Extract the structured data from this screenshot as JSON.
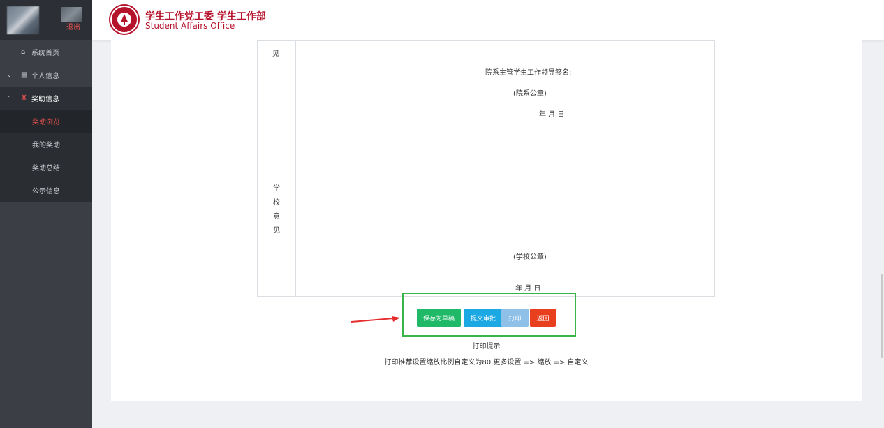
{
  "sidebar": {
    "logout": "退出",
    "menu": [
      {
        "label": "系统首页",
        "icon": "home-icon"
      },
      {
        "label": "个人信息",
        "icon": "id-card-icon"
      },
      {
        "label": "奖助信息",
        "icon": "award-icon"
      }
    ],
    "submenu": [
      "奖助浏览",
      "我的奖助",
      "奖助总结",
      "公示信息"
    ]
  },
  "header": {
    "title_cn": "学生工作党工委 学生工作部",
    "title_en": "Student Affairs Office"
  },
  "form": {
    "row1_label": "见",
    "leader_sign": "院系主管学生工作领导签名:",
    "dept_seal": "(院系公章)",
    "date1": "年  月  日",
    "school_label": [
      "学",
      "校",
      "意",
      "见"
    ],
    "school_seal": "(学校公章)",
    "date2": "年  月  日"
  },
  "buttons": {
    "save": "保存为草稿",
    "submit": "提交审批",
    "print": "打印",
    "back": "返回"
  },
  "hint": {
    "title": "打印提示",
    "body": "打印推荐设置缩放比例自定义为80,更多设置 => 缩放 => 自定义"
  },
  "colors": {
    "brand": "#b5122b",
    "save": "#1fb968",
    "submit": "#1ca8e3",
    "print": "#8fc0e8",
    "back": "#e8401f",
    "highlight": "#38b449",
    "arrow": "#e52d2d"
  }
}
